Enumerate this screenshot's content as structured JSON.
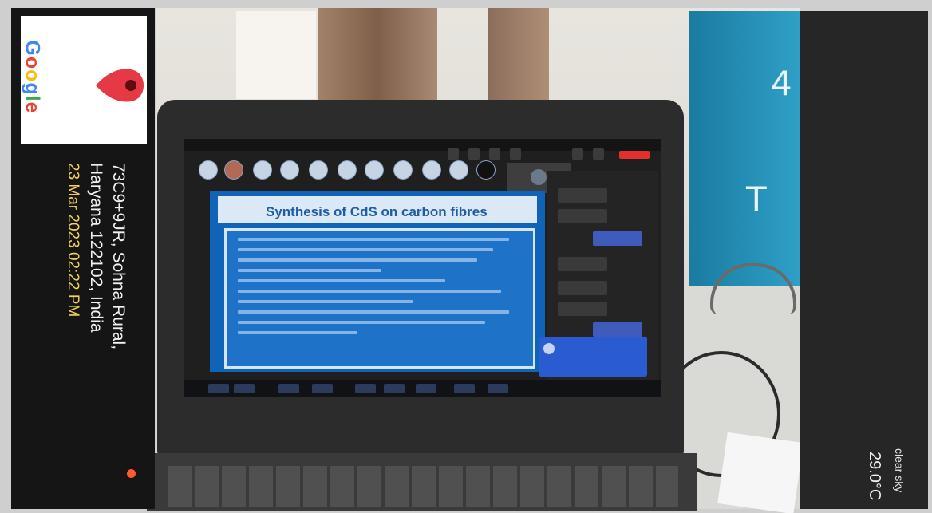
{
  "stamp": {
    "brand_letters": [
      {
        "char": "G",
        "color": "#4285F4"
      },
      {
        "char": "o",
        "color": "#EA4335"
      },
      {
        "char": "o",
        "color": "#FBBC05"
      },
      {
        "char": "g",
        "color": "#4285F4"
      },
      {
        "char": "l",
        "color": "#34A853"
      },
      {
        "char": "e",
        "color": "#EA4335"
      }
    ],
    "pin_icon": "map-pin-icon",
    "address_line1": "73C9+9JR, Sohna Rural,",
    "address_line2": "Haryana 122102, India",
    "timestamp": "23 Mar 2023 02:22 PM",
    "weather": "clear sky",
    "temperature": "29.0°C",
    "colors": {
      "pin": "#e63946",
      "timestamp": "#f3d25b",
      "weather_dot": "#ff5a2a"
    }
  },
  "meeting": {
    "slide_title": "Synthesis of CdS on carbon fibres"
  }
}
